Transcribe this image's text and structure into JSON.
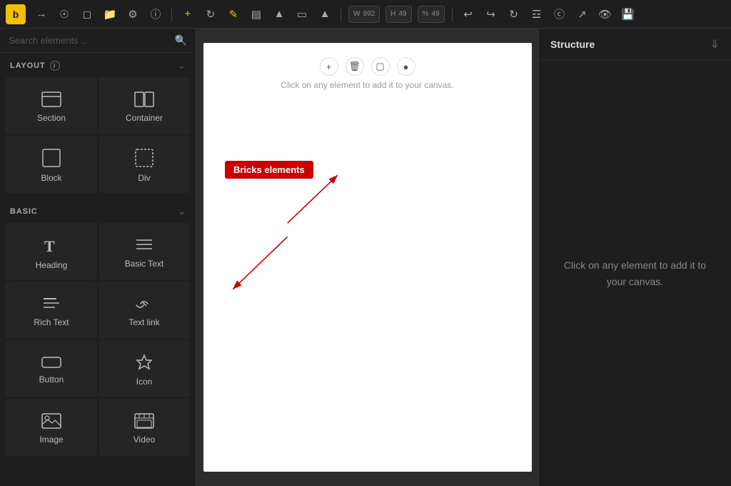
{
  "toolbar": {
    "logo": "b",
    "width_label": "W",
    "width_value": "992",
    "height_label": "H",
    "height_value": "49",
    "percent": "%",
    "zoom_value": "49"
  },
  "sidebar": {
    "search_placeholder": "Search elements ..",
    "layout_section": "LAYOUT",
    "basic_section": "BASIC",
    "layout_items": [
      {
        "id": "section",
        "label": "Section",
        "icon": "▭"
      },
      {
        "id": "container",
        "label": "Container",
        "icon": "⊞"
      },
      {
        "id": "block",
        "label": "Block",
        "icon": "□"
      },
      {
        "id": "div",
        "label": "Div",
        "icon": "▱"
      }
    ],
    "basic_items": [
      {
        "id": "heading",
        "label": "Heading",
        "icon": "T"
      },
      {
        "id": "basic-text",
        "label": "Basic Text",
        "icon": "≡"
      },
      {
        "id": "rich-text",
        "label": "Rich Text",
        "icon": "≡"
      },
      {
        "id": "text-link",
        "label": "Text link",
        "icon": "⚇"
      },
      {
        "id": "button",
        "label": "Button",
        "icon": "▭"
      },
      {
        "id": "icon",
        "label": "Icon",
        "icon": "☆"
      },
      {
        "id": "image",
        "label": "Image",
        "icon": "🖼"
      },
      {
        "id": "video",
        "label": "Video",
        "icon": "▦"
      }
    ]
  },
  "canvas": {
    "hint": "Click on any element to add it to your canvas.",
    "bricks_label": "Bricks elements"
  },
  "right_panel": {
    "title": "Structure",
    "placeholder": "Click on any element to add it to your canvas."
  }
}
